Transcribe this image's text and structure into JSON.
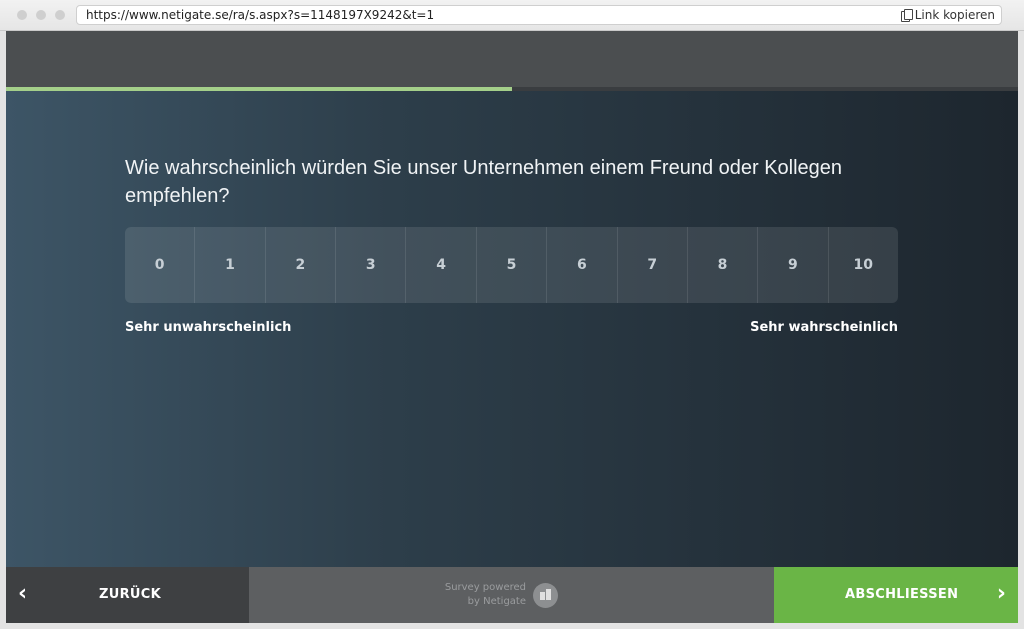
{
  "browser": {
    "url": "https://www.netigate.se/ra/s.aspx?s=1148197X9242&t=1",
    "copy_link_label": "Link kopieren"
  },
  "survey": {
    "progress_fraction": 0.5,
    "question": "Wie wahrscheinlich würden Sie unser Unternehmen einem Freund oder Kollegen empfehlen?",
    "scale_options": [
      "0",
      "1",
      "2",
      "3",
      "4",
      "5",
      "6",
      "7",
      "8",
      "9",
      "10"
    ],
    "low_anchor": "Sehr unwahrscheinlich",
    "high_anchor": "Sehr wahrscheinlich"
  },
  "footer": {
    "back_label": "ZURÜCK",
    "back_icon": "chevron-left-icon",
    "powered_line1": "Survey powered",
    "powered_line2": "by Netigate",
    "logo_icon": "netigate-logo-icon",
    "finish_label": "ABSCHLIESSEN",
    "finish_icon": "chevron-right-icon"
  },
  "colors": {
    "progress": "#a4cf8a",
    "finish_button": "#6ab546",
    "back_button": "#3e4042"
  }
}
